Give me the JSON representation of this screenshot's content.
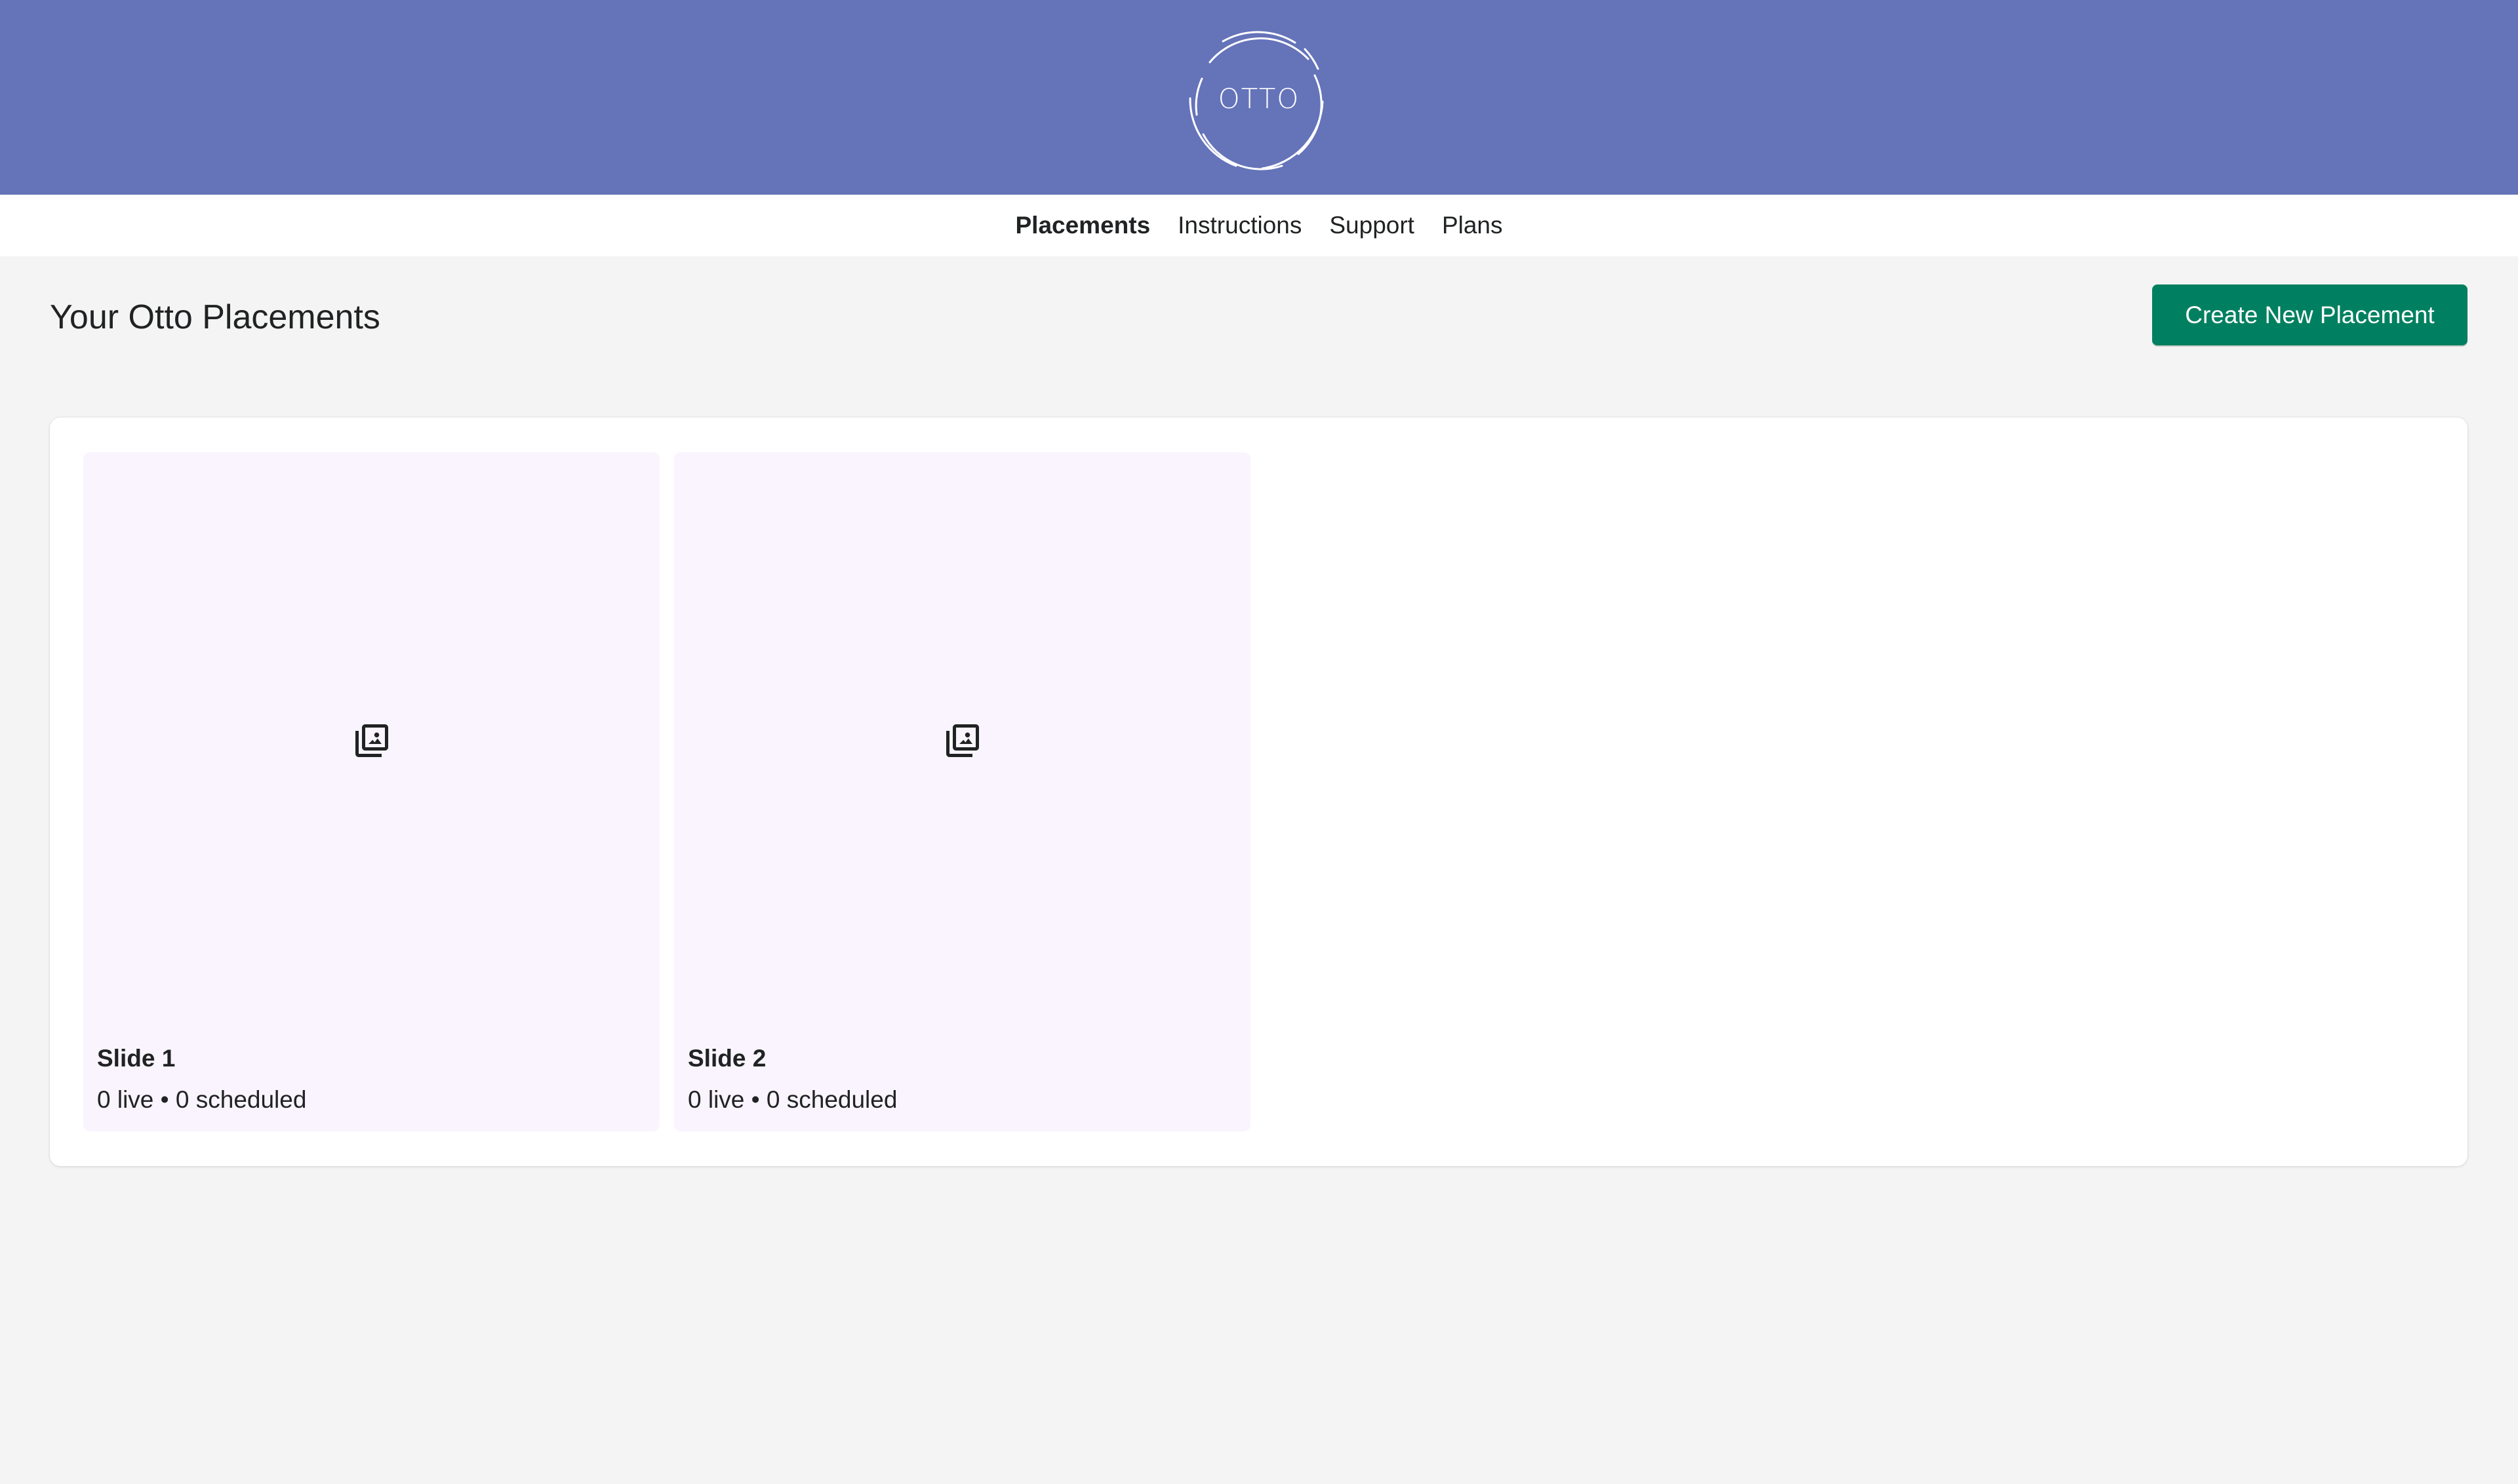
{
  "header": {
    "logo_text": "OTTO",
    "background_color": "#6573b9"
  },
  "nav": {
    "items": [
      {
        "label": "Placements",
        "active": true
      },
      {
        "label": "Instructions",
        "active": false
      },
      {
        "label": "Support",
        "active": false
      },
      {
        "label": "Plans",
        "active": false
      }
    ]
  },
  "page": {
    "title": "Your Otto Placements",
    "create_button_label": "Create New Placement",
    "accent_color": "#008060"
  },
  "placements": [
    {
      "title": "Slide 1",
      "meta": "0 live • 0 scheduled",
      "icon": "image-gallery-icon"
    },
    {
      "title": "Slide 2",
      "meta": "0 live • 0 scheduled",
      "icon": "image-gallery-icon"
    }
  ]
}
